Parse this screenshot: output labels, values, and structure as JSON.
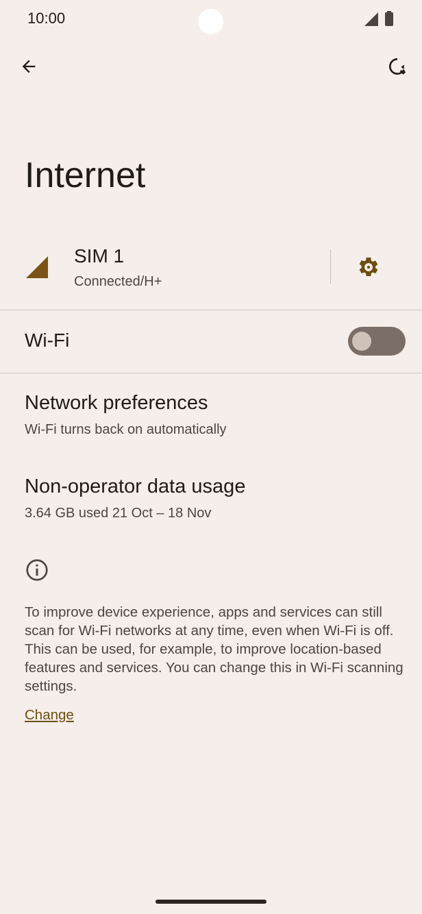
{
  "status_bar": {
    "time": "10:00",
    "icons": [
      "signal-icon",
      "battery-icon"
    ]
  },
  "toolbar": {
    "back_icon": "arrow-left-icon",
    "refresh_icon": "refresh-icon"
  },
  "page": {
    "title": "Internet"
  },
  "sim": {
    "title": "SIM 1",
    "status": "Connected/H+",
    "icon": "cell-signal-icon",
    "settings_icon": "gear-icon"
  },
  "wifi": {
    "label": "Wi-Fi",
    "enabled": false
  },
  "network_preferences": {
    "title": "Network preferences",
    "subtitle": "Wi-Fi turns back on automatically"
  },
  "data_usage": {
    "title": "Non-operator data usage",
    "subtitle": "3.64 GB used 21 Oct – 18 Nov"
  },
  "footer": {
    "info_icon": "info-icon",
    "text": "To improve device experience, apps and services can still scan for Wi-Fi networks at any time, even when Wi-Fi is off. This can be used, for example, to improve location-based features and services. You can change this in Wi-Fi scanning settings.",
    "link": "Change"
  },
  "colors": {
    "background": "#f5eeea",
    "accent": "#6b4f12",
    "toggle_track": "#7a6e66"
  }
}
